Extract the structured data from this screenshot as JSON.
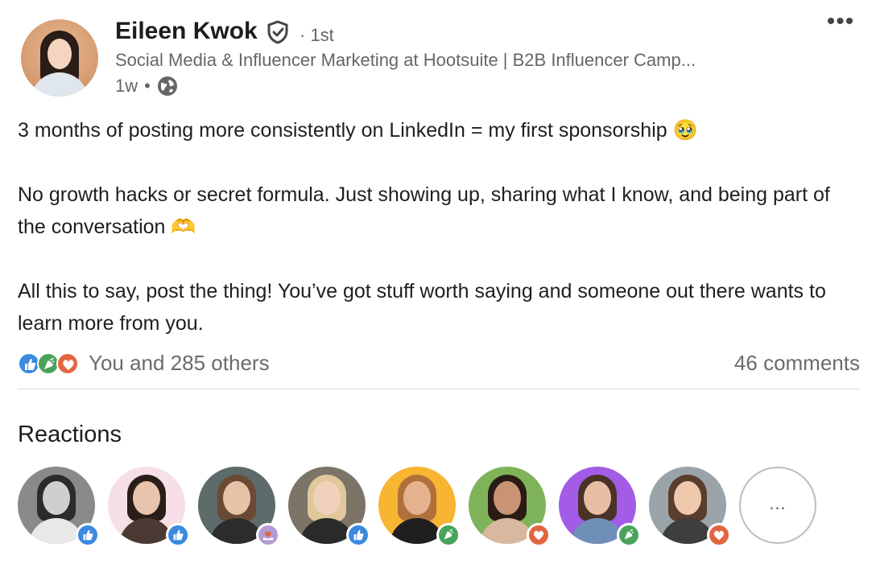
{
  "post": {
    "author": {
      "name": "Eileen Kwok",
      "degree": "· 1st",
      "headline": "Social Media & Influencer Marketing at Hootsuite | B2B Influencer Camp...",
      "time": "1w",
      "time_separator": "•"
    },
    "more_menu": "•••",
    "body": {
      "p1": "3 months of posting more consistently on LinkedIn = my first sponsorship 🥹",
      "p2": "No growth hacks or secret formula. Just showing up, sharing what I know, and being part of the conversation 🫶",
      "p3": "All this to say, post the thing! You’ve got stuff worth saying and someone out there wants to learn more from you."
    },
    "social": {
      "reactions_text": "You and 285 others",
      "comments_text": "46 comments",
      "reaction_icons": [
        "like-icon",
        "celebrate-icon",
        "love-icon"
      ]
    }
  },
  "reactions_panel": {
    "title": "Reactions",
    "more_label": "...",
    "reactors": [
      {
        "reaction": "like"
      },
      {
        "reaction": "like"
      },
      {
        "reaction": "support"
      },
      {
        "reaction": "like"
      },
      {
        "reaction": "celebrate"
      },
      {
        "reaction": "love"
      },
      {
        "reaction": "celebrate"
      },
      {
        "reaction": "love"
      }
    ]
  },
  "colors": {
    "like": "#3b8ae0",
    "celebrate": "#4aa35b",
    "love": "#e2653f",
    "support": "#b49ad6"
  }
}
